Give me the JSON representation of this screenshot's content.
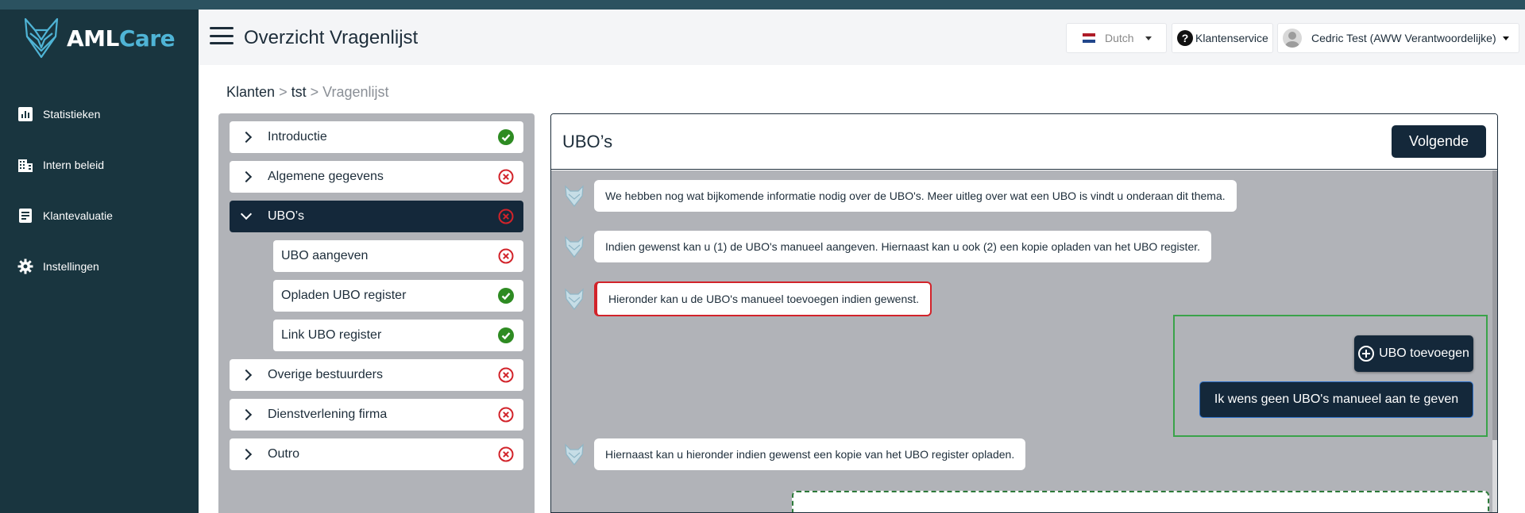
{
  "app": {
    "logo_aml": "AML",
    "logo_care": "Care"
  },
  "sidebar": {
    "items": [
      {
        "label": "Statistieken",
        "icon": "bar-chart-icon"
      },
      {
        "label": "Intern beleid",
        "icon": "building-icon"
      },
      {
        "label": "Klantevaluatie",
        "icon": "document-icon"
      },
      {
        "label": "Instellingen",
        "icon": "gear-icon"
      }
    ]
  },
  "header": {
    "title": "Overzicht Vragenlijst",
    "language": "Dutch",
    "service": "Klantenservice",
    "user": "Cedric Test (AWW Verantwoordelijke)"
  },
  "breadcrumb": {
    "part1": "Klanten",
    "sep": ">",
    "part2": "tst",
    "part3": "Vragenlijst"
  },
  "questionnaire": {
    "items": [
      {
        "label": "Introductie",
        "status": "complete"
      },
      {
        "label": "Algemene gegevens",
        "status": "incomplete"
      },
      {
        "label": "UBO’s",
        "status": "incomplete",
        "active": true
      },
      {
        "label": "UBO aangeven",
        "status": "incomplete",
        "sub": true
      },
      {
        "label": "Opladen UBO register",
        "status": "complete",
        "sub": true
      },
      {
        "label": "Link UBO register",
        "status": "complete",
        "sub": true
      },
      {
        "label": "Overige bestuurders",
        "status": "incomplete"
      },
      {
        "label": "Dienstverlening firma",
        "status": "incomplete"
      },
      {
        "label": "Outro",
        "status": "incomplete"
      }
    ]
  },
  "panel": {
    "title": "UBO’s",
    "next_label": "Volgende",
    "messages": [
      "We hebben nog wat bijkomende informatie nodig over de UBO's. Meer uitleg over wat een UBO is vindt u onderaan dit thema.",
      "Indien gewenst kan u (1) de UBO's manueel aangeven. Hiernaast kan u ook (2) een kopie opladen van het UBO register.",
      "Hieronder kan u de UBO's manueel toevoegen indien gewenst.",
      "Hiernaast kan u hieronder indien gewenst een kopie van het UBO register opladen."
    ],
    "add_label": "UBO toevoegen",
    "none_label": "Ik wens geen UBO's manueel aan te geven"
  },
  "colors": {
    "sidebar": "#19353f",
    "accent": "#4fb4d6",
    "dark_button": "#14283a",
    "complete": "#2e8b22",
    "incomplete": "#d2232a"
  }
}
